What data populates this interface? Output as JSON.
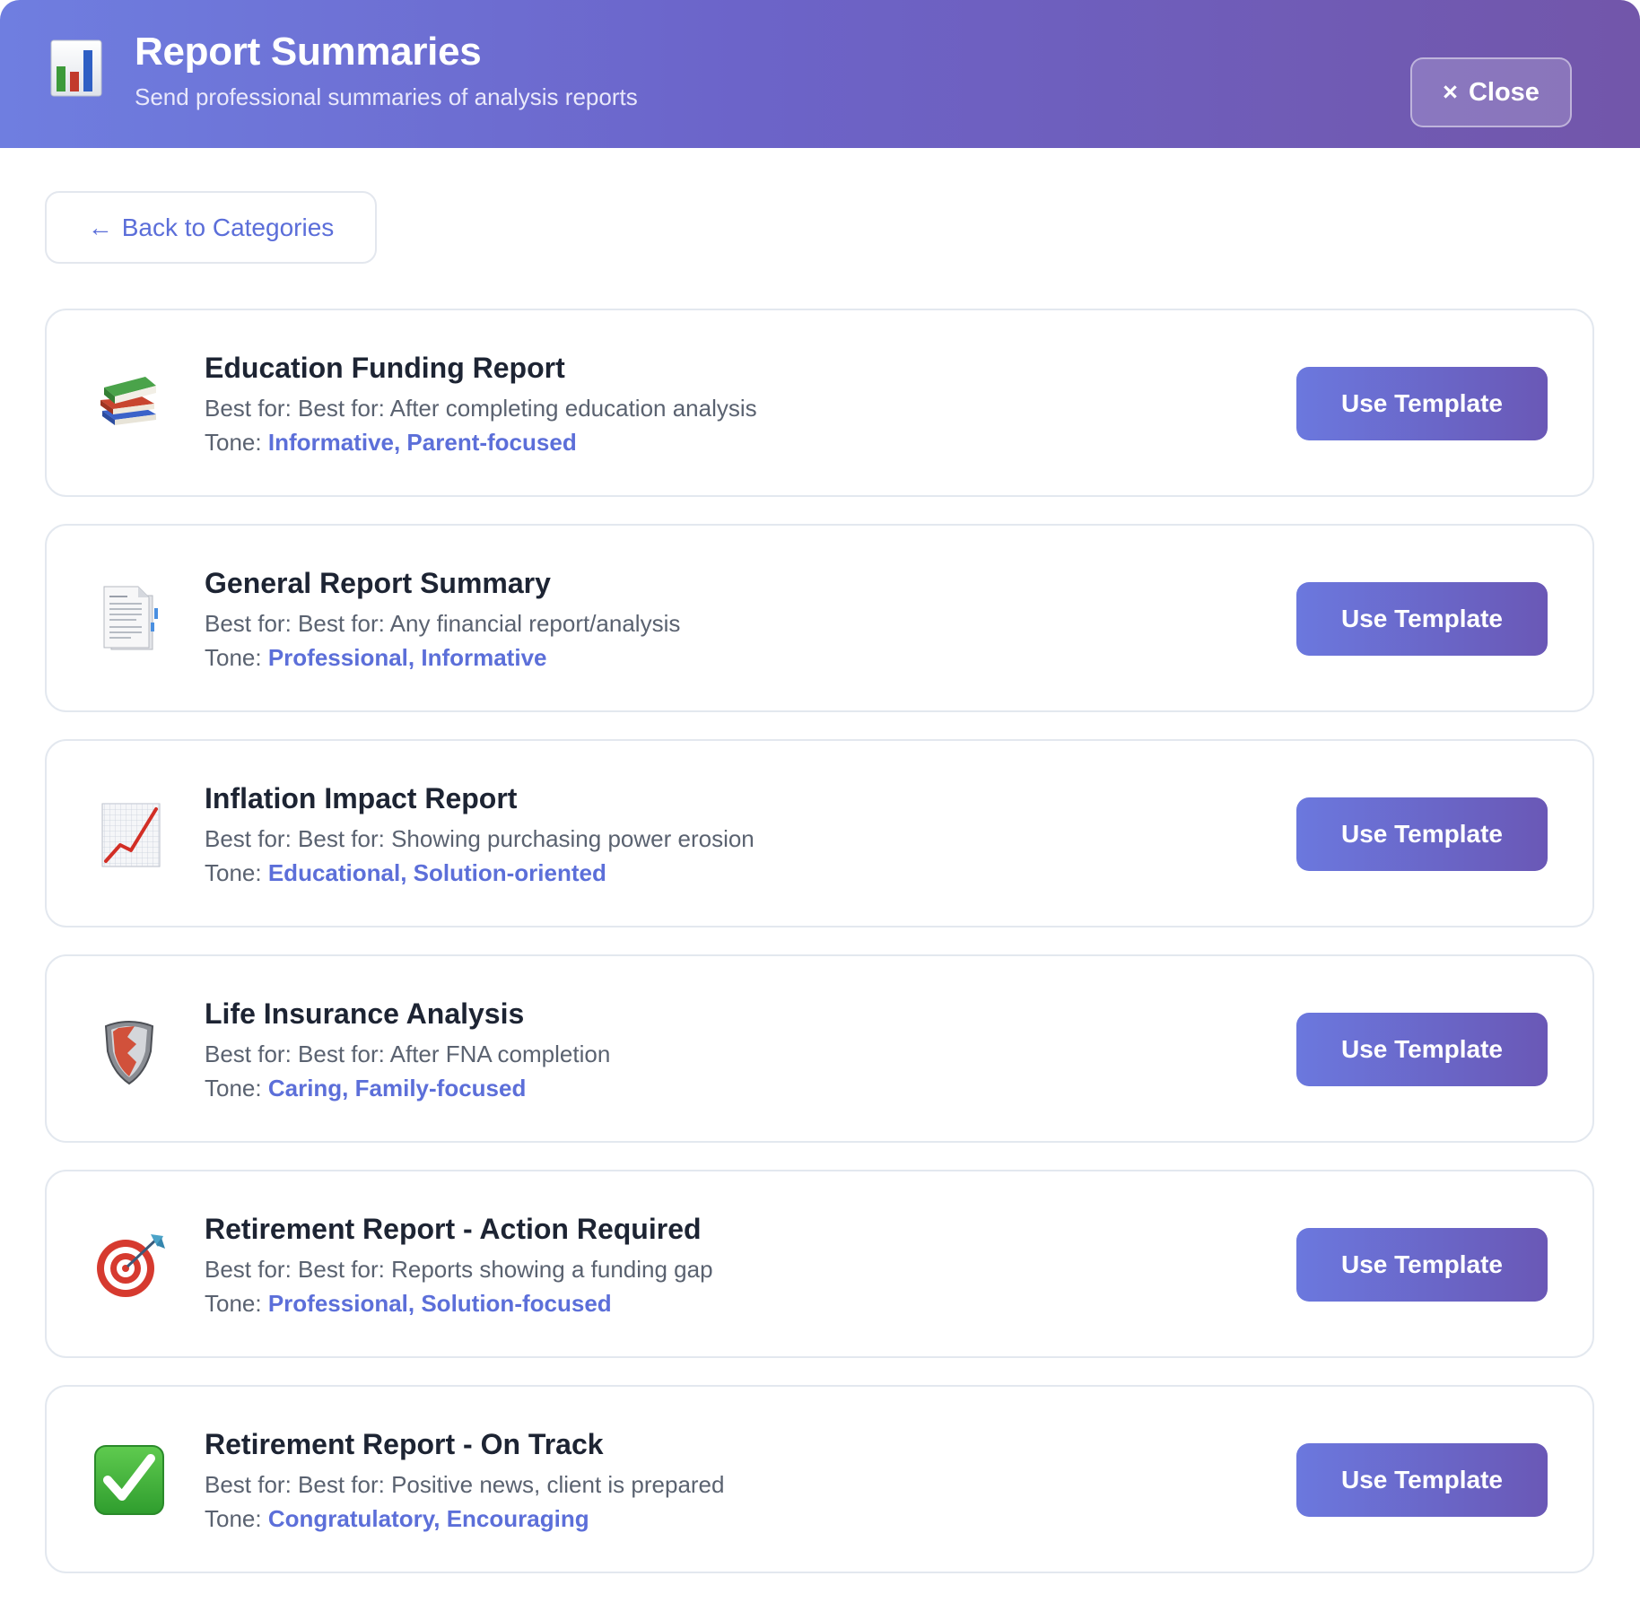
{
  "header": {
    "title": "Report Summaries",
    "subtitle": "Send professional summaries of analysis reports",
    "icon": "bar-chart-icon",
    "close_icon": "×",
    "close_label": "Close"
  },
  "back_button": {
    "arrow": "←",
    "label": "Back to Categories"
  },
  "tone_prefix": "Tone:",
  "use_template_label": "Use Template",
  "templates": [
    {
      "icon": "books-icon",
      "title": "Education Funding Report",
      "best_for": "Best for: Best for: After completing education analysis",
      "tone": "Informative, Parent-focused"
    },
    {
      "icon": "document-icon",
      "title": "General Report Summary",
      "best_for": "Best for: Best for: Any financial report/analysis",
      "tone": "Professional, Informative"
    },
    {
      "icon": "chart-increasing-icon",
      "title": "Inflation Impact Report",
      "best_for": "Best for: Best for: Showing purchasing power erosion",
      "tone": "Educational, Solution-oriented"
    },
    {
      "icon": "shield-icon",
      "title": "Life Insurance Analysis",
      "best_for": "Best for: Best for: After FNA completion",
      "tone": "Caring, Family-focused"
    },
    {
      "icon": "target-icon",
      "title": "Retirement Report - Action Required",
      "best_for": "Best for: Best for: Reports showing a funding gap",
      "tone": "Professional, Solution-focused"
    },
    {
      "icon": "check-mark-icon",
      "title": "Retirement Report - On Track",
      "best_for": "Best for: Best for: Positive news, client is prepared",
      "tone": "Congratulatory, Encouraging"
    }
  ],
  "colors": {
    "accent": "#5c6fd9",
    "header_start": "#6f7ee0",
    "header_end": "#7256aa"
  }
}
